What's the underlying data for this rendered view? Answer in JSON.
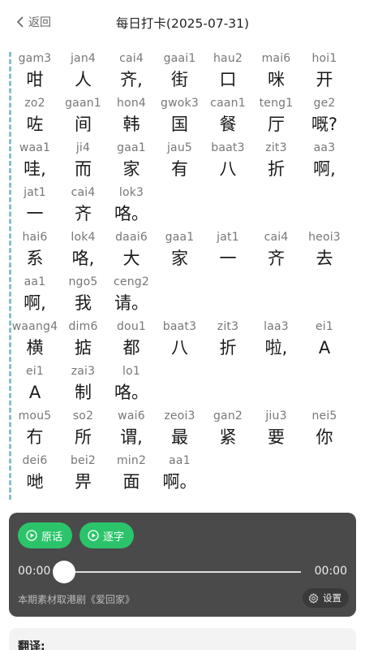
{
  "header": {
    "back_label": "返回",
    "title": "每日打卡(2025-07-31)"
  },
  "lines": [
    [
      [
        "gam3",
        "咁"
      ],
      [
        "jan4",
        "人"
      ],
      [
        "cai4",
        "齐,"
      ],
      [
        "gaai1",
        "街"
      ],
      [
        "hau2",
        "口"
      ],
      [
        "mai6",
        "咪"
      ],
      [
        "hoi1",
        "开"
      ]
    ],
    [
      [
        "zo2",
        "咗"
      ],
      [
        "gaan1",
        "间"
      ],
      [
        "hon4",
        "韩"
      ],
      [
        "gwok3",
        "国"
      ],
      [
        "caan1",
        "餐"
      ],
      [
        "teng1",
        "厅"
      ],
      [
        "ge2",
        "嘅?"
      ]
    ],
    [
      [
        "waa1",
        "哇,"
      ],
      [
        "ji4",
        "而"
      ],
      [
        "gaa1",
        "家"
      ],
      [
        "jau5",
        "有"
      ],
      [
        "baat3",
        "八"
      ],
      [
        "zit3",
        "折"
      ],
      [
        "aa3",
        "啊,"
      ]
    ],
    [
      [
        "jat1",
        "一"
      ],
      [
        "cai4",
        "齐"
      ],
      [
        "lok3",
        "咯。"
      ]
    ],
    [
      [
        "hai6",
        "系"
      ],
      [
        "lok4",
        "咯,"
      ],
      [
        "daai6",
        "大"
      ],
      [
        "gaa1",
        "家"
      ],
      [
        "jat1",
        "一"
      ],
      [
        "cai4",
        "齐"
      ],
      [
        "heoi3",
        "去"
      ]
    ],
    [
      [
        "aa1",
        "啊,"
      ],
      [
        "ngo5",
        "我"
      ],
      [
        "ceng2",
        "请。"
      ]
    ],
    [
      [
        "waang4",
        "横"
      ],
      [
        "dim6",
        "掂"
      ],
      [
        "dou1",
        "都"
      ],
      [
        "baat3",
        "八"
      ],
      [
        "zit3",
        "折"
      ],
      [
        "laa3",
        "啦,"
      ],
      [
        "ei1",
        "A"
      ]
    ],
    [
      [
        "ei1",
        "A"
      ],
      [
        "zai3",
        "制"
      ],
      [
        "lo1",
        "咯。"
      ]
    ],
    [
      [
        "mou5",
        "冇"
      ],
      [
        "so2",
        "所"
      ],
      [
        "wai6",
        "谓,"
      ],
      [
        "zeoi3",
        "最"
      ],
      [
        "gan2",
        "紧"
      ],
      [
        "jiu3",
        "要"
      ],
      [
        "nei5",
        "你"
      ]
    ],
    [
      [
        "dei6",
        "哋"
      ],
      [
        "bei2",
        "畀"
      ],
      [
        "min2",
        "面"
      ],
      [
        "aa1",
        "啊。"
      ]
    ]
  ],
  "player": {
    "original_button": "原话",
    "word_button": "逐字",
    "time_current": "00:00",
    "time_total": "00:00",
    "progress": 0,
    "source_note": "本期素材取港剧《爱回家》",
    "settings_label": "设置"
  },
  "translation": {
    "heading": "翻译:"
  },
  "colors": {
    "accent_green": "#2bc46a",
    "player_bg": "#4a4a4a",
    "dashed_bar": "#7fc4c6"
  }
}
